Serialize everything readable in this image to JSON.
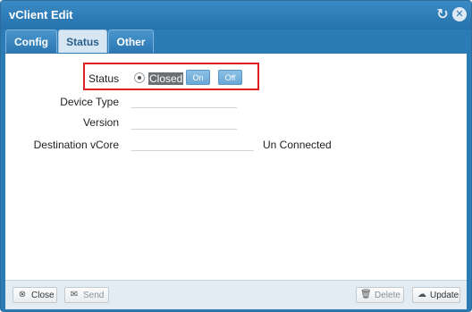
{
  "window": {
    "title": "vClient Edit"
  },
  "tabs": [
    {
      "label": "Config"
    },
    {
      "label": "Status"
    },
    {
      "label": "Other"
    }
  ],
  "form": {
    "status_label": "Status",
    "status_value": "Closed",
    "on_label": "On",
    "off_label": "Off",
    "device_type_label": "Device Type",
    "device_type_value": "",
    "version_label": "Version",
    "version_value": "",
    "destination_label": "Destination vCore",
    "destination_value": "",
    "destination_status": "Un Connected"
  },
  "footer": {
    "close_label": "Close",
    "send_label": "Send",
    "delete_label": "Delete",
    "update_label": "Update"
  },
  "colors": {
    "accent": "#2b7bb5",
    "highlight": "#e02020",
    "active_tab": "#d7e6f3"
  }
}
